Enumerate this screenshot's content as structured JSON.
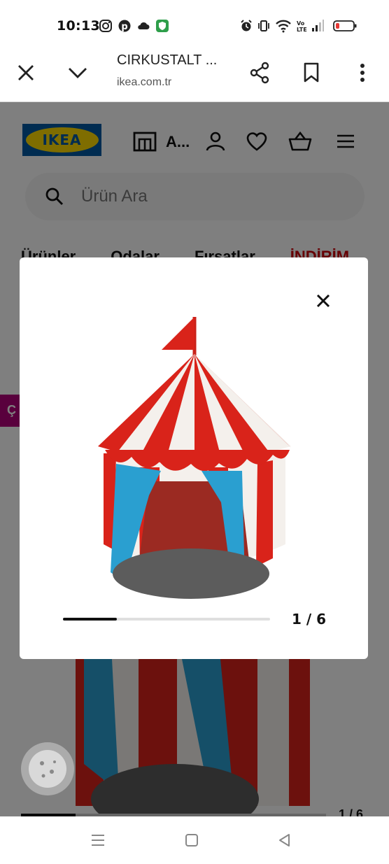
{
  "status_bar": {
    "time": "10:13",
    "left_icons": [
      "instagram-icon",
      "pinterest-icon",
      "cloud-icon",
      "vpn-shield-icon"
    ],
    "right_icons": [
      "alarm-icon",
      "vibrate-icon",
      "wifi-icon",
      "volte-icon",
      "signal-icon",
      "battery-icon"
    ],
    "battery_color": "#e53935"
  },
  "browser": {
    "title": "CIRKUSTALT ...",
    "url": "ikea.com.tr",
    "icons": [
      "close-icon",
      "chevron-down-icon",
      "share-icon",
      "bookmark-icon",
      "more-vert-icon"
    ]
  },
  "site_header": {
    "logo_text": "IKEA",
    "store_label": "A...",
    "icons": [
      "store-icon",
      "account-icon",
      "heart-icon",
      "basket-icon",
      "menu-icon"
    ],
    "brand_blue": "#0058a3",
    "brand_yellow": "#ffdb00"
  },
  "search": {
    "placeholder": "Ürün Ara"
  },
  "nav": {
    "items": [
      "Ürünler",
      "Odalar",
      "Fırsatlar",
      "İNDİRİM"
    ],
    "sale_color": "#cc0008"
  },
  "side_tab": {
    "label": "Ç"
  },
  "modal": {
    "image_alt": "CIRKUSTÄLT children's tent",
    "counter": "1 / 6",
    "progress_fraction": 0.26
  },
  "background_gallery": {
    "counter": "1 / 6"
  },
  "system_nav": {
    "icons": [
      "recents-icon",
      "home-icon",
      "back-icon"
    ]
  }
}
